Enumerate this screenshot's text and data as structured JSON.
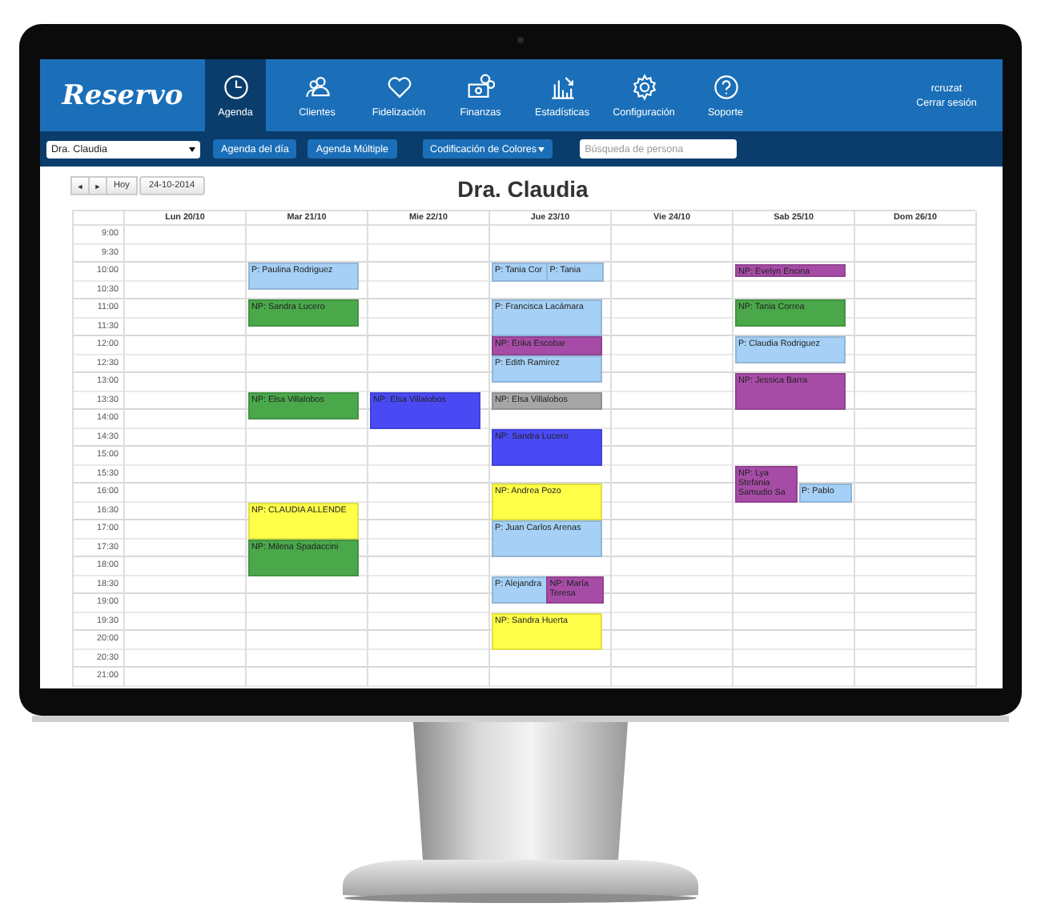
{
  "nav": {
    "logo": "Reservo",
    "items": [
      {
        "label": "Agenda",
        "selected": true
      },
      {
        "label": "Clientes",
        "selected": false
      },
      {
        "label": "Fidelización",
        "selected": false
      },
      {
        "label": "Finanzas",
        "selected": false
      },
      {
        "label": "Estadísticas",
        "selected": false
      },
      {
        "label": "Configuración",
        "selected": false
      },
      {
        "label": "Soporte",
        "selected": false
      }
    ],
    "user": "rcruzat",
    "logout": "Cerrar sesión"
  },
  "toolbar": {
    "professional": "Dra. Claudia",
    "buttons": [
      "Agenda del día",
      "Agenda Múltiple"
    ],
    "color_menu": "Codificación de Colores",
    "search": {
      "placeholder": "Búsqueda de persona"
    }
  },
  "calendar": {
    "prev": "◄",
    "next": "►",
    "today": "Hoy",
    "date": "24-10-2014",
    "title": "Dra. Claudia",
    "times": [
      "9:00",
      "9:30",
      "10:00",
      "10:30",
      "11:00",
      "11:30",
      "12:00",
      "12:30",
      "13:00",
      "13:30",
      "14:00",
      "14:30",
      "15:00",
      "15:30",
      "16:00",
      "16:30",
      "17:00",
      "17:30",
      "18:00",
      "18:30",
      "19:00",
      "19:30",
      "20:00",
      "20:30",
      "21:00"
    ],
    "days": [
      {
        "label": "Lun 20/10"
      },
      {
        "label": "Mar 21/10",
        "column": [
          {
            "kind": "free"
          },
          {
            "kind": "free"
          },
          {
            "kind": "three-quarter",
            "label": "P: Paulina Rodriguez",
            "color": "#a6d0f5"
          },
          {
            "kind": "three-quarter",
            "label": "NP: Sandra Lucero",
            "color": "#4aa84a"
          },
          {
            "kind": "free"
          },
          {
            "kind": "free"
          },
          {
            "kind": "free"
          },
          {
            "kind": "three-quarter",
            "label": "NP: Elsa Villalobos",
            "color": "#4aa84a"
          },
          {
            "kind": "free"
          },
          {
            "kind": "free"
          },
          {
            "kind": "free"
          },
          {
            "kind": "free"
          },
          {
            "kind": "hour",
            "label": "NP: CLAUDIA ALLENDE",
            "color": "#ffff4a"
          },
          {
            "kind": "hour",
            "label": "NP: Milena Spadaccini",
            "color": "#4aa84a"
          }
        ]
      },
      {
        "label": "Mie 22/10",
        "column": [
          {
            "kind": "free"
          },
          {
            "kind": "free"
          },
          {
            "kind": "free"
          },
          {
            "kind": "free"
          },
          {
            "kind": "free"
          },
          {
            "kind": "free"
          },
          {
            "kind": "free"
          },
          {
            "kind": "free"
          },
          {
            "kind": "free"
          },
          {
            "kind": "hour",
            "label": "NP: Elsa Villalobos",
            "color": "#4a4af5"
          }
        ]
      },
      {
        "label": "Jue 23/10",
        "column": [
          {
            "kind": "free"
          },
          {
            "kind": "free"
          },
          {
            "kind": "pair",
            "bookings": [
              {
                "kind": "half",
                "label": "P: Tania Cor",
                "color": "#a6d0f5"
              },
              {
                "kind": "half",
                "label": "P: Tania",
                "color": "#a6d0f5"
              }
            ]
          },
          {
            "kind": "free"
          },
          {
            "kind": "hour",
            "label": "P: Francisca Lacámara",
            "color": "#a6d0f5"
          },
          {
            "kind": "half",
            "label": "NP: Erika Escobar",
            "color": "#a64ca6"
          },
          {
            "kind": "three-quarter",
            "label": "P: Edith Ramirez",
            "color": "#a6d0f5"
          },
          {
            "kind": "half",
            "label": "NP: Elsa Villalobos",
            "color": "#a6a6a6"
          },
          {
            "kind": "free"
          },
          {
            "kind": "hour",
            "label": "NP: Sandra Lucero",
            "color": "#4a4af5"
          },
          {
            "kind": "free"
          },
          {
            "kind": "hour",
            "label": "NP: Andrea Pozo",
            "color": "#ffff4a"
          },
          {
            "kind": "hour",
            "label": "P: Juan Carlos Arenas",
            "color": "#a6d0f5"
          },
          {
            "kind": "free"
          },
          {
            "kind": "pair",
            "bookings": [
              {
                "kind": "three-quarter",
                "label": "P: Alejandra",
                "color": "#a6d0f5"
              },
              {
                "kind": "three-quarter",
                "label": "NP: María Teresa",
                "color": "#a64ca6"
              }
            ]
          },
          {
            "kind": "hour",
            "label": "NP: Sandra Huerta",
            "color": "#ffff4a"
          }
        ]
      },
      {
        "label": "Vie 24/10"
      },
      {
        "label": "Sab 25/10",
        "column": [
          {
            "kind": "free"
          },
          {
            "kind": "free"
          },
          {
            "kind": "short",
            "label": "NP: Evelyn Encina",
            "color": "#a64ca6"
          },
          {
            "kind": "free"
          },
          {
            "kind": "three-quarter",
            "label": "NP: Tania Correa",
            "color": "#4aa84a"
          },
          {
            "kind": "three-quarter",
            "label": "P: Claudia Rodriguez",
            "color": "#a6d0f5"
          },
          {
            "kind": "hour",
            "label": "NP: Jessica Barra",
            "color": "#a64ca6"
          },
          {
            "kind": "free"
          },
          {
            "kind": "free"
          },
          {
            "kind": "free"
          },
          {
            "kind": "pair",
            "bookings": [
              {
                "kind": "hour",
                "label": "NP: Lya Stefania Samudio Sa",
                "color": "#a64ca6"
              },
              {
                "kind": "late-half",
                "label": "P: Pablo",
                "color": "#a6d0f5"
              }
            ]
          }
        ]
      },
      {
        "label": "Dom 26/10"
      }
    ]
  }
}
